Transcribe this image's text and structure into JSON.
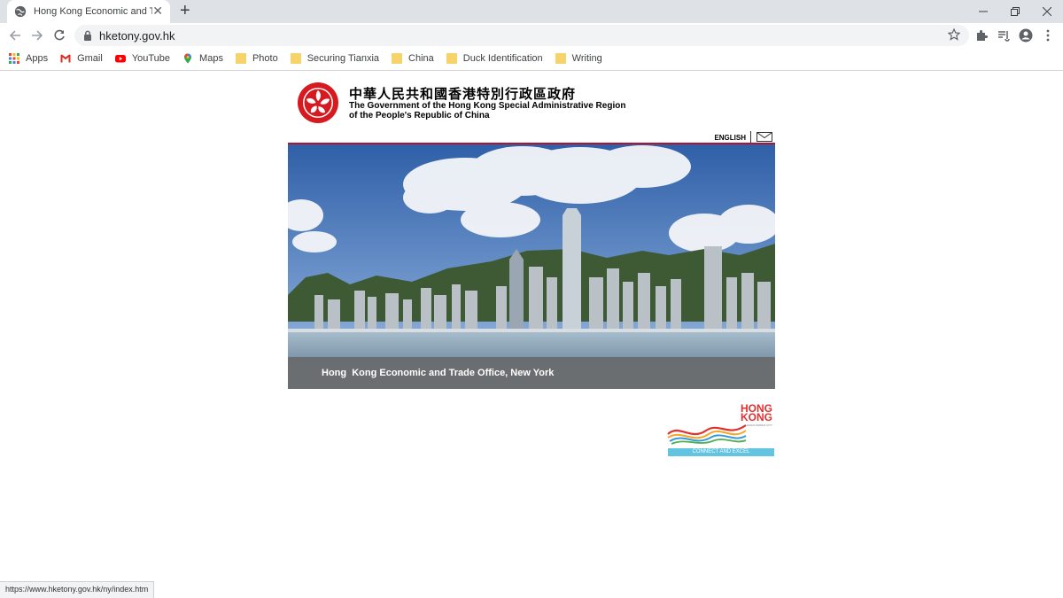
{
  "browser": {
    "tab_title": "Hong Kong Economic and Trade",
    "url": "hketony.gov.hk",
    "bookmarks": [
      {
        "label": "Apps",
        "icon": "apps-grid-icon"
      },
      {
        "label": "Gmail",
        "icon": "gmail-icon"
      },
      {
        "label": "YouTube",
        "icon": "youtube-icon"
      },
      {
        "label": "Maps",
        "icon": "maps-icon"
      },
      {
        "label": "Photo",
        "icon": "folder-icon"
      },
      {
        "label": "Securing Tianxia",
        "icon": "folder-icon"
      },
      {
        "label": "China",
        "icon": "folder-icon"
      },
      {
        "label": "Duck Identification",
        "icon": "folder-icon"
      },
      {
        "label": "Writing",
        "icon": "folder-icon"
      }
    ],
    "status_url": "https://www.hketony.gov.hk/ny/index.htm"
  },
  "header": {
    "gov_chinese": "中華人民共和國香港特別行政區政府",
    "gov_english_line1": "The Government of the Hong Kong Special Administrative Region",
    "gov_english_line2": "of the People's Republic of China",
    "language_link": "ENGLISH"
  },
  "hero": {
    "caption": "Hong  Kong Economic and Trade Office, New York"
  },
  "brand": {
    "line1": "HONG",
    "line2": "KONG",
    "tagline": "ASIA'S WORLD CITY",
    "bar_text": "CONNECT AND EXCEL"
  },
  "colors": {
    "accent_red": "#b0152d",
    "caption_gray": "#6b6e70",
    "brand_red": "#e0312f",
    "brand_blue": "#62c4e0"
  }
}
